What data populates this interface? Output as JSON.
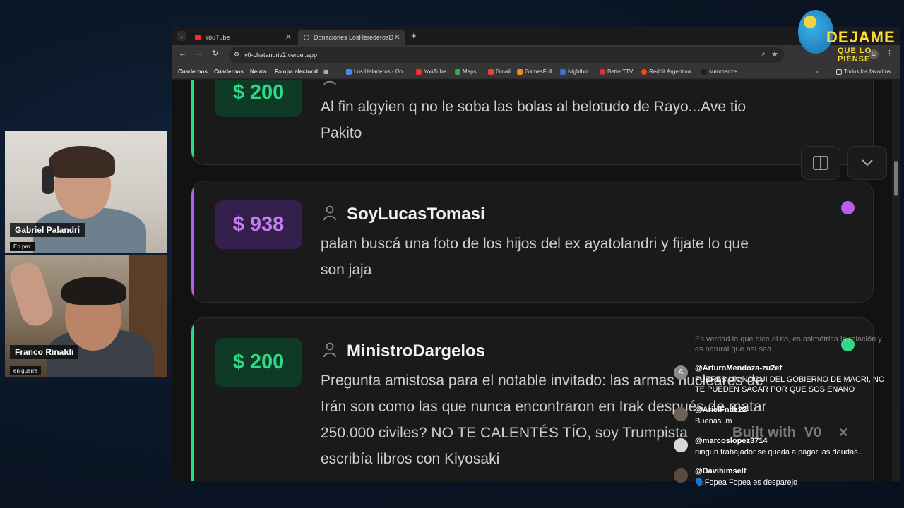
{
  "webcams": [
    {
      "name": "Gabriel Palandri",
      "status": "En paz"
    },
    {
      "name": "Franco Rinaldi",
      "status": "en guerra"
    }
  ],
  "logo": {
    "line1": "DEJAME",
    "line2": "QUE LO PIENSE"
  },
  "browser": {
    "tabs": [
      {
        "label": "YouTube",
        "icon": "youtube-icon"
      },
      {
        "label": "Donaciones LosHerederosDeAl",
        "icon": "globe-icon"
      }
    ],
    "url": "v0-chatandriv2.vercel.app",
    "bookmarks": [
      {
        "label": "Cuadernos",
        "bold": true
      },
      {
        "label": "Cuadernos",
        "bold": true
      },
      {
        "label": "Neura",
        "bold": true
      },
      {
        "label": "Falopa electoral",
        "bold": true
      },
      {
        "label": "Los Heladeros - Go..."
      },
      {
        "label": "YouTube"
      },
      {
        "label": "Maps"
      },
      {
        "label": "Gmail"
      },
      {
        "label": "GamesFull"
      },
      {
        "label": "Nightbot"
      },
      {
        "label": "BetterTTV"
      },
      {
        "label": "Reddit Argentina"
      },
      {
        "label": "summarize"
      },
      {
        "label": "Todos los favoritos"
      }
    ]
  },
  "donations": [
    {
      "amount": "$ 200",
      "user": "",
      "message_lines": [
        "Al fin algyien q no le soba las bolas al belotudo de Rayo...Ave tio",
        "Pakito"
      ],
      "color": "#2fd985"
    },
    {
      "amount": "$ 938",
      "user": "SoyLucasTomasi",
      "message_lines": [
        "palan buscá una foto de los hijos del ex ayatolandri y fijate lo que",
        "son jaja"
      ],
      "color": "#b35ff0"
    },
    {
      "amount": "$ 200",
      "user": "MinistroDargelos",
      "message_lines": [
        "Pregunta amistosa para el notable invitado: las armas nucleares de",
        "Irán son como las que nunca encontraron en Irak después de matar",
        "250.000 civiles? NO TE CALENTÉS TÍO, soy Trumpista",
        "escribía libros con Kiyosaki"
      ],
      "color": "#2fd985"
    }
  ],
  "built_with": "Built with",
  "chat": [
    {
      "user": "",
      "text": "Es verdad lo que dice el tio, es asimétrica la relación y es natural que así sea"
    },
    {
      "user": "@ArturoMendoza-zu2ef",
      "text": "FUERES UN NOQUI DEL GOBIERNO DE MACRI, NO TE PUEDEN SACAR POR QUE SOS ENANO"
    },
    {
      "user": "@ArielFndz22",
      "text": "Buenas..m"
    },
    {
      "user": "@marcoslopez3714",
      "text": "ningun trabajador se queda a pagar las deudas.."
    },
    {
      "user": "@Davihimself",
      "text": "🗣️Fopea Fopea es desparejo"
    }
  ]
}
